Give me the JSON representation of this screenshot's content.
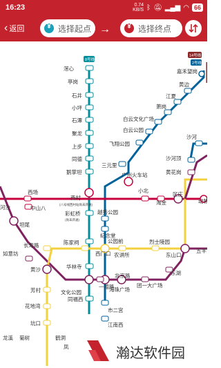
{
  "status_bar": {
    "time": "16:23",
    "speed_top": "0.74",
    "speed_bottom": "KB/S",
    "icons": [
      "bluetooth-icon",
      "mute-icon",
      "signal-icon",
      "wifi-icon"
    ],
    "battery": "66"
  },
  "nav": {
    "back_label": "返回",
    "origin_placeholder": "选择起点",
    "destination_placeholder": "选择终点",
    "separator": "→",
    "accent": "#c4232d",
    "origin_pin_color": "#1aa0b8",
    "destination_pin_color": "#c4232d"
  },
  "map": {
    "line_colors": {
      "line2": "#00629b",
      "line3": "#ecb100",
      "line8": "#008e9c",
      "line6": "#80225f",
      "line1": "#f3d03e",
      "line5": "#c5003e",
      "line14": "#8a2a2b"
    },
    "line_badges": {
      "line8": "8号线",
      "line2": "2号线",
      "line14": "14号线"
    },
    "stations": {
      "s1": "滘心",
      "s2": "亭岗",
      "s3": "石井",
      "s4": "小坪",
      "s5": "石潭",
      "s6": "聚龙",
      "s7": "上步",
      "s8": "同德",
      "s9": "鹅掌坦",
      "s10": "西村",
      "s11": "(八号线西村站尚未开通)",
      "s12": "彩虹桥",
      "s13": "(尚未开通)",
      "s14": "陈家祠",
      "s15": "华林寺",
      "s16": "文化公园",
      "s17": "同福西",
      "s18": "凤",
      "s19": "嘉禾望岗",
      "s20": "黄边",
      "s21": "江夏",
      "s22": "萧岗",
      "s23": "白云文化广场",
      "s24": "白云公园",
      "s25": "飞翔公园",
      "s26": "三元里",
      "s27": "广州火车站",
      "s28": "小北",
      "s29": "越秀公园",
      "s30": "纪念堂",
      "s31": "公园前",
      "s32": "西门口",
      "s33": "农讲所",
      "s34": "烈士陵园",
      "s35": "东山口",
      "s36": "北京路",
      "s37": "一德路",
      "s38": "海珠广场",
      "s39": "团一大广场",
      "s40": "东湖",
      "s41": "市二宫",
      "s42": "江南西",
      "s43": "沙河",
      "s44": "沙河顶",
      "s45": "黄花岗",
      "s46": "区庄",
      "s47": "淘金",
      "s48": "动物",
      "s49": "五羊",
      "s50": "西场",
      "s51": "中山八",
      "s52": "坦尾",
      "s53": "河沙",
      "s54": "长寿路",
      "s55": "如意坊",
      "s56": "黄沙",
      "s57": "芳村",
      "s58": "花地湾",
      "s59": "坑口",
      "s60": "龙溪",
      "s61": "菊树",
      "s62": "鹤洞"
    }
  },
  "watermark": {
    "text": "瀚达软件园",
    "logo_color": "#c4232d"
  }
}
